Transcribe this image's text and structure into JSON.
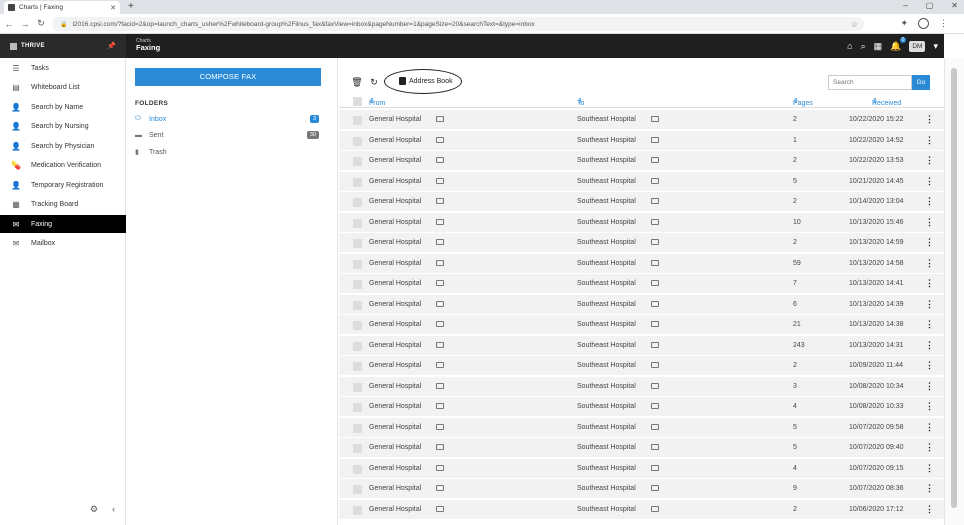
{
  "browser": {
    "tab_title": "Charts | Faxing",
    "url": "l2016.cpsi.com/?facid=2&op=launch_charts_usher%2Fwhiteboard-group%2Flinus_fax&faxView=inbox&pageNumber=1&pageSize=20&searchText=&type=inbox"
  },
  "app": {
    "brand": "THRIVE",
    "module_sub": "Charts",
    "module_title": "Faxing",
    "notification_count": "0",
    "user_initials": "DM"
  },
  "nav": {
    "items": [
      {
        "label": "Tasks",
        "icon": "tasks-icon"
      },
      {
        "label": "Whiteboard List",
        "icon": "whiteboard-icon"
      },
      {
        "label": "Search by Name",
        "icon": "person-search-icon"
      },
      {
        "label": "Search by Nursing",
        "icon": "nurse-icon"
      },
      {
        "label": "Search by Physician",
        "icon": "physician-icon"
      },
      {
        "label": "Medication Verification",
        "icon": "medication-icon"
      },
      {
        "label": "Temporary Registration",
        "icon": "registration-icon"
      },
      {
        "label": "Tracking Board",
        "icon": "tracking-icon"
      },
      {
        "label": "Faxing",
        "icon": "fax-icon"
      },
      {
        "label": "Mailbox",
        "icon": "mailbox-icon"
      }
    ],
    "active_index": 8
  },
  "folders": {
    "compose_label": "COMPOSE FAX",
    "title": "FOLDERS",
    "items": [
      {
        "label": "Inbox",
        "count": "3"
      },
      {
        "label": "Sent",
        "count": "30"
      },
      {
        "label": "Trash",
        "count": ""
      }
    ]
  },
  "toolbar": {
    "address_book_label": "Address Book",
    "search_placeholder": "Search",
    "go_label": "Go"
  },
  "table": {
    "headers": {
      "from": "From",
      "to": "To",
      "pages": "Pages",
      "received": "Received"
    },
    "rows": [
      {
        "from": "General Hospital",
        "to": "Southeast Hospital",
        "pages": "2",
        "received": "10/22/2020 15:22"
      },
      {
        "from": "General Hospital",
        "to": "Southeast Hospital",
        "pages": "1",
        "received": "10/22/2020 14:52"
      },
      {
        "from": "General Hospital",
        "to": "Southeast Hospital",
        "pages": "2",
        "received": "10/22/2020 13:53"
      },
      {
        "from": "General Hospital",
        "to": "Southeast Hospital",
        "pages": "5",
        "received": "10/21/2020 14:45"
      },
      {
        "from": "General Hospital",
        "to": "Southeast Hospital",
        "pages": "2",
        "received": "10/14/2020 13:04"
      },
      {
        "from": "General Hospital",
        "to": "Southeast Hospital",
        "pages": "10",
        "received": "10/13/2020 15:46"
      },
      {
        "from": "General Hospital",
        "to": "Southeast Hospital",
        "pages": "2",
        "received": "10/13/2020 14:59"
      },
      {
        "from": "General Hospital",
        "to": "Southeast Hospital",
        "pages": "59",
        "received": "10/13/2020 14:58"
      },
      {
        "from": "General Hospital",
        "to": "Southeast Hospital",
        "pages": "7",
        "received": "10/13/2020 14:41"
      },
      {
        "from": "General Hospital",
        "to": "Southeast Hospital",
        "pages": "6",
        "received": "10/13/2020 14:39"
      },
      {
        "from": "General Hospital",
        "to": "Southeast Hospital",
        "pages": "21",
        "received": "10/13/2020 14:38"
      },
      {
        "from": "General Hospital",
        "to": "Southeast Hospital",
        "pages": "243",
        "received": "10/13/2020 14:31"
      },
      {
        "from": "General Hospital",
        "to": "Southeast Hospital",
        "pages": "2",
        "received": "10/09/2020 11:44"
      },
      {
        "from": "General Hospital",
        "to": "Southeast Hospital",
        "pages": "3",
        "received": "10/08/2020 10:34"
      },
      {
        "from": "General Hospital",
        "to": "Southeast Hospital",
        "pages": "4",
        "received": "10/08/2020 10:33"
      },
      {
        "from": "General Hospital",
        "to": "Southeast Hospital",
        "pages": "5",
        "received": "10/07/2020 09:58"
      },
      {
        "from": "General Hospital",
        "to": "Southeast Hospital",
        "pages": "5",
        "received": "10/07/2020 09:40"
      },
      {
        "from": "General Hospital",
        "to": "Southeast Hospital",
        "pages": "4",
        "received": "10/07/2020 09:15"
      },
      {
        "from": "General Hospital",
        "to": "Southeast Hospital",
        "pages": "9",
        "received": "10/07/2020 08:36"
      },
      {
        "from": "General Hospital",
        "to": "Southeast Hospital",
        "pages": "2",
        "received": "10/06/2020 17:12"
      }
    ]
  },
  "colors": {
    "accent": "#2a8ad6",
    "header_bg": "#1f1f1f",
    "row_bg": "#f2f2f2"
  }
}
